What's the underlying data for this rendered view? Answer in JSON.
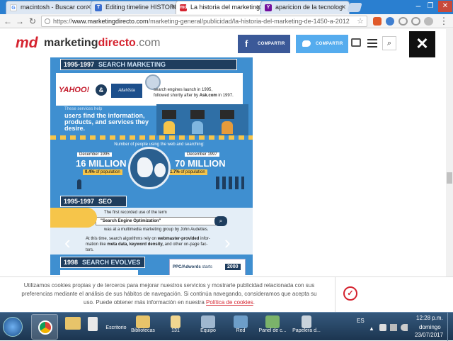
{
  "browser": {
    "tabs": [
      {
        "label": "macintosh - Buscar con",
        "favicon": "G",
        "active": false
      },
      {
        "label": "Editing timeline HISTORI",
        "favicon": "T",
        "active": false
      },
      {
        "label": "La historia del marketing",
        "favicon": "md",
        "active": true
      },
      {
        "label": "aparicion de la tecnolog",
        "favicon": "Y",
        "active": false
      }
    ],
    "url_prefix": "https://",
    "url_domain": "www.marketingdirecto.com",
    "url_path": "/marketing-general/publicidad/la-historia-del-marketing-de-1450-a-2012"
  },
  "site": {
    "logo_md": "md",
    "logo_text_a": "marketing",
    "logo_text_b": "directo",
    "logo_text_c": ".com",
    "facebook_label": "COMPARTIR",
    "twitter_label": "COMPARTIR"
  },
  "infographic": {
    "section1_years": "1995-1997",
    "section1_title": "SEARCH MARKETING",
    "yahoo": "YAHOO!",
    "altavista": "AltaVista",
    "launch_text_a": "search engines launch in 1995,",
    "launch_text_b": "followed shortly after by ",
    "launch_text_c": "Ask.com",
    "launch_text_d": " in 1997.",
    "services_a": "These services help",
    "services_b": "users find the information,",
    "services_c": "products, and services they",
    "services_d": "desire.",
    "people_label": "Number of people using the web and searching:",
    "dec1995": "December 1995",
    "million16": "16 MILLION",
    "pct1995_value": "0.4%",
    "pct1995_rest": " of population",
    "dec1997": "December 1997",
    "million70": "70 MILLION",
    "pct1997_value": "1.7%",
    "pct1997_rest": " of population",
    "section2_years": "1995-1997",
    "section2_title": "SEO",
    "seo_text_a": "The first recorded use of the term",
    "seo_search_term": "\"Search Engine Optimization\"",
    "seo_text_b": "was at a multimedia marketing group by John Audettes.",
    "algo_a": "At this time, search algorithms rely on ",
    "algo_b": "webmaster-provided",
    "algo_c": " infor-",
    "algo_d": "mation like ",
    "algo_e": "meta data, keyword density,",
    "algo_f": " and other on-page fac-",
    "algo_g": "tors.",
    "section3_year": "1998",
    "section3_title": "SEARCH EVOLVES",
    "ppc_a": "PPC/Adwords",
    "ppc_b": " starts",
    "ppc_year": "2000"
  },
  "cookie": {
    "line1": "Utilizamos cookies propias y de terceros para mejorar nuestros servicios y mostrarle publicidad relacionada con sus",
    "line2": "preferencias mediante el análisis de sus hábitos de navegación. Si continúa navegando, consideramos que acepta su",
    "line3a": "uso. Puede obtener más información en nuestra ",
    "line3link": "Política de cookies",
    "line3b": "."
  },
  "taskbar": {
    "items": [
      {
        "label": "Escritorio"
      },
      {
        "label": "Bibliotecas"
      },
      {
        "label": "131"
      },
      {
        "label": "Equipo"
      },
      {
        "label": "Red"
      },
      {
        "label": "Panel de c..."
      },
      {
        "label": "Papelera d..."
      }
    ],
    "language": "ES",
    "time": "12:28 p.m.",
    "day": "domingo",
    "date": "23/07/2017"
  },
  "colors": {
    "facebook": "#3b5998",
    "twitter": "#55acee",
    "infographic_bg": "#3f8fd0",
    "accent_yellow": "#f6c54a",
    "brand_red": "#d5232f"
  }
}
